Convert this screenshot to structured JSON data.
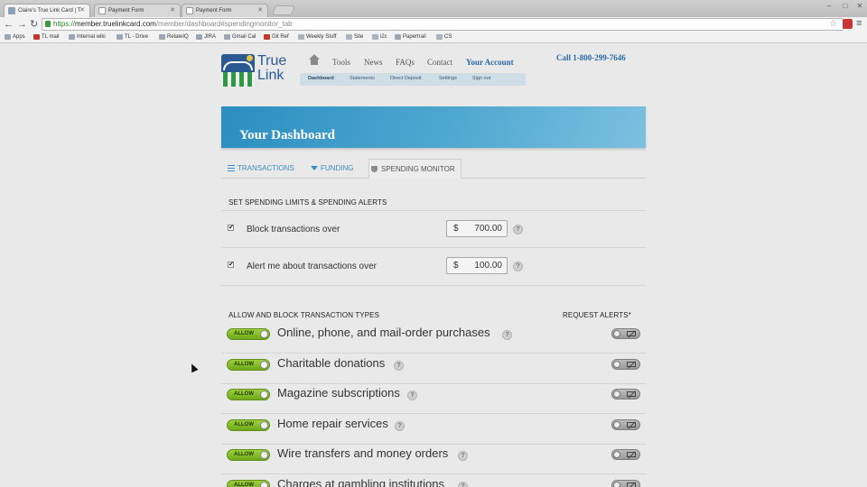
{
  "browser": {
    "tabs": [
      {
        "title": "Claire's True Link Card | T"
      },
      {
        "title": "Payment Form"
      },
      {
        "title": "Payment Form"
      }
    ],
    "url_scheme": "https://",
    "url_host": "member.truelinkcard.com",
    "url_path": "/member/dashboard#spendingmonitor_tab",
    "bookmarks": [
      "Apps",
      "TL mail",
      "Internal wiki",
      "TL - Drive",
      "RelateIQ",
      "JIRA",
      "Gmail Cal",
      "Git Ref",
      "Weekly Stuff",
      "Site",
      "i2c",
      "Papertrail",
      "CS"
    ]
  },
  "site": {
    "logo_line1": "True",
    "logo_line2": "Link",
    "nav": [
      "Tools",
      "News",
      "FAQs",
      "Contact",
      "Your Account"
    ],
    "subnav": [
      "Dashboard",
      "Statements",
      "Direct Deposit",
      "Settings",
      "Sign out"
    ],
    "call": "Call 1-800-299-7646"
  },
  "dashboard": {
    "title": "Your Dashboard",
    "tabs": [
      "TRANSACTIONS",
      "FUNDING",
      "SPENDING MONITOR"
    ]
  },
  "limits": {
    "section_title": "SET SPENDING LIMITS & SPENDING ALERTS",
    "rows": [
      {
        "label": "Block transactions over",
        "currency": "$",
        "amount": "700.00",
        "checked": true
      },
      {
        "label": "Alert me about transactions over",
        "currency": "$",
        "amount": "100.00",
        "checked": true
      }
    ]
  },
  "types": {
    "section_title": "ALLOW AND BLOCK TRANSACTION TYPES",
    "alerts_header": "REQUEST ALERTS*",
    "allow_label": "ALLOW",
    "help_glyph": "?",
    "check_glyph": "✔",
    "rows": [
      {
        "label": "Online, phone, and mail-order purchases"
      },
      {
        "label": "Charitable donations"
      },
      {
        "label": "Magazine subscriptions"
      },
      {
        "label": "Home repair services"
      },
      {
        "label": "Wire transfers and money orders"
      },
      {
        "label": "Charges at gambling institutions"
      }
    ]
  },
  "colors": {
    "brand_blue": "#2b5a93",
    "link_blue": "#2a6aa6",
    "allow_green": "#8cc63f"
  }
}
